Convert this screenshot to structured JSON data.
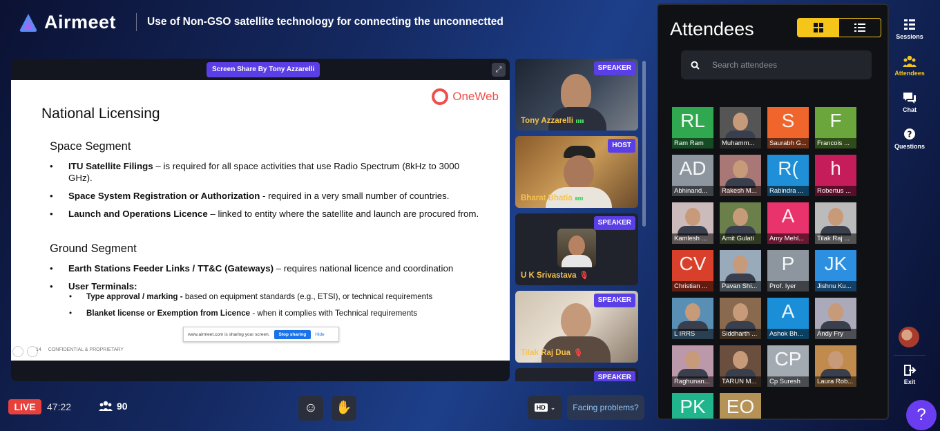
{
  "brand": {
    "name": "Airmeet",
    "accent": "#5b3fe6"
  },
  "event": {
    "title": "Use of Non-GSO satellite technology for connecting the unconnectted"
  },
  "stage": {
    "share_badge": "Screen Share By Tony Azzarelli",
    "fullscreen_icon": "expand-icon",
    "slide": {
      "logo": "OneWeb",
      "title": "National Licensing",
      "space_segment": {
        "heading": "Space Segment",
        "bullets": [
          {
            "bold": "ITU Satellite Filings",
            "text": " – is required for all space activities that use Radio Spectrum (8kHz to 3000 GHz)."
          },
          {
            "bold": "Space System Registration or Authorization",
            "text": " -  required in a very small number of countries."
          },
          {
            "bold": "Launch and Operations Licence",
            "text": " – linked to entity where the satellite and launch are procured from."
          }
        ]
      },
      "ground_segment": {
        "heading": "Ground Segment",
        "bullets": [
          {
            "bold": "Earth Stations Feeder Links / TT&C (Gateways)",
            "text": " – requires national licence and coordination"
          },
          {
            "bold": "User Terminals:",
            "text": ""
          }
        ],
        "sub_bullets": [
          {
            "bold": "Type approval / marking -",
            "text": " based on equipment standards (e.g., ETSI), or technical requirements"
          },
          {
            "bold": "Blanket license or Exemption from Licence",
            "text": " -  when it complies with Technical requirements"
          }
        ]
      },
      "sharing_bar": {
        "message": "www.airmeet.com is sharing your screen.",
        "stop": "Stop sharing",
        "hide": "Hide"
      },
      "footer": {
        "page": "14",
        "label": "CONFIDENTIAL & PROPRIETARY"
      }
    }
  },
  "speakers": [
    {
      "name": "Tony Azzarelli",
      "role": "SPEAKER",
      "mic": "active"
    },
    {
      "name": "Bharat Bhatia",
      "role": "HOST",
      "mic": "active"
    },
    {
      "name": "U K Srivastava",
      "role": "SPEAKER",
      "mic": "muted"
    },
    {
      "name": "Tilak Raj Dua",
      "role": "SPEAKER",
      "mic": "muted"
    },
    {
      "name": "",
      "role": "SPEAKER",
      "mic": ""
    }
  ],
  "bottom_bar": {
    "live": "LIVE",
    "timer": "47:22",
    "attendee_count": "90",
    "emoji_icon": "smile-icon",
    "raise_hand_icon": "hand-icon",
    "quality": "HD",
    "problems": "Facing problems?"
  },
  "attendees_panel": {
    "title": "Attendees",
    "search_placeholder": "Search attendees",
    "attendees": [
      {
        "name": "Ram Ram",
        "initials": "RL",
        "color": "#2fa84f",
        "photo": false
      },
      {
        "name": "Muhamm...",
        "initials": "",
        "color": "#555",
        "photo": true
      },
      {
        "name": "Saurabh G...",
        "initials": "S",
        "color": "#f0652b",
        "photo": false
      },
      {
        "name": "Francois ...",
        "initials": "F",
        "color": "#6aa63b",
        "photo": false
      },
      {
        "name": "Abhinand...",
        "initials": "AD",
        "color": "#8d969e",
        "photo": false
      },
      {
        "name": "Rakesh M...",
        "initials": "",
        "color": "#a77",
        "photo": true
      },
      {
        "name": "Rabindra ...",
        "initials": "R(",
        "color": "#1f8fd8",
        "photo": false
      },
      {
        "name": "Robertus ...",
        "initials": "h",
        "color": "#c51d5a",
        "photo": false
      },
      {
        "name": "Kamlesh ...",
        "initials": "",
        "color": "#cbb",
        "photo": true
      },
      {
        "name": "Amit Gulati",
        "initials": "",
        "color": "#6b7f4a",
        "photo": true
      },
      {
        "name": "Amy Mehl...",
        "initials": "A",
        "color": "#e8336d",
        "photo": false
      },
      {
        "name": "Tilak Raj ...",
        "initials": "",
        "color": "#bbb",
        "photo": true
      },
      {
        "name": "Christian ...",
        "initials": "CV",
        "color": "#d9402b",
        "photo": false
      },
      {
        "name": "Pavan Shi...",
        "initials": "",
        "color": "#9ab",
        "photo": true
      },
      {
        "name": "Prof. Iyer",
        "initials": "P",
        "color": "#8d969e",
        "photo": false
      },
      {
        "name": "Jishnu Ku...",
        "initials": "JK",
        "color": "#2d8fe0",
        "photo": false
      },
      {
        "name": "L IRRS",
        "initials": "",
        "color": "#5a8fb5",
        "photo": true
      },
      {
        "name": "Siddharth ...",
        "initials": "",
        "color": "#8a6a4e",
        "photo": true
      },
      {
        "name": "Ashok Bh...",
        "initials": "A",
        "color": "#1a8fd8",
        "photo": false
      },
      {
        "name": "Andy Fry",
        "initials": "",
        "color": "#aab",
        "photo": true
      },
      {
        "name": "Raghunan...",
        "initials": "",
        "color": "#b9a",
        "photo": true
      },
      {
        "name": "TARUN M...",
        "initials": "",
        "color": "#6a4e3e",
        "photo": true
      },
      {
        "name": "Cp Suresh",
        "initials": "CP",
        "color": "#a3aab2",
        "photo": false
      },
      {
        "name": "Laura Rob...",
        "initials": "",
        "color": "#c28b4e",
        "photo": true
      },
      {
        "name": "",
        "initials": "PK",
        "color": "#21b58e",
        "photo": false
      },
      {
        "name": "",
        "initials": "EO",
        "color": "#b59256",
        "photo": false
      }
    ]
  },
  "right_rail": {
    "items": [
      {
        "label": "Sessions",
        "icon": "sessions-icon"
      },
      {
        "label": "Attendees",
        "icon": "people-icon"
      },
      {
        "label": "Chat",
        "icon": "chat-icon"
      },
      {
        "label": "Questions",
        "icon": "question-icon"
      }
    ],
    "exit": "Exit",
    "help_icon": "help-icon"
  }
}
